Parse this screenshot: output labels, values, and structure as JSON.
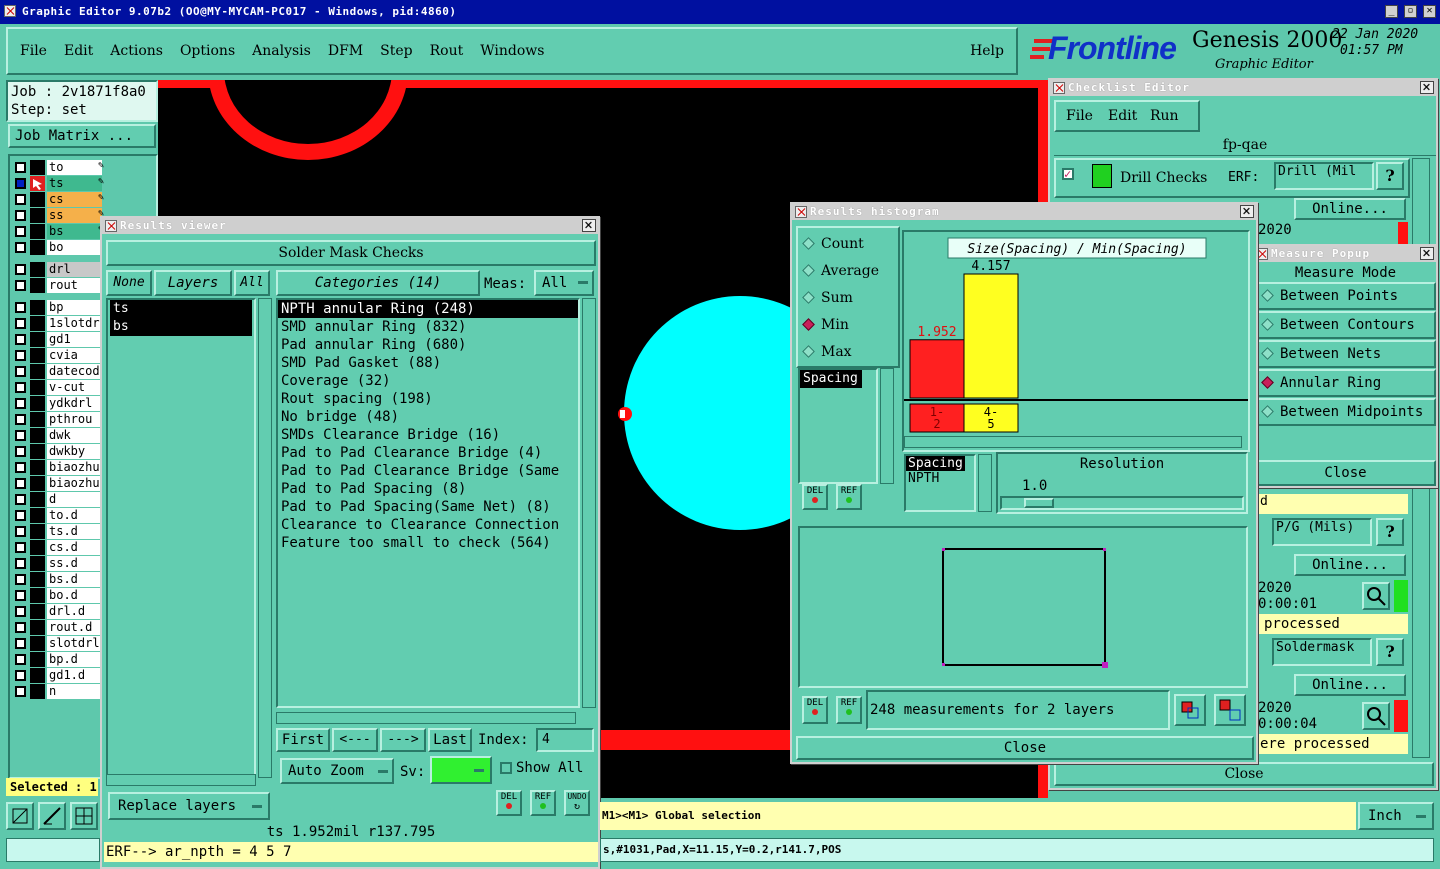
{
  "window": {
    "title": "Graphic Editor 9.07b2 (OO@MY-MYCAM-PC017 - Windows, pid:4860)"
  },
  "menu": [
    "File",
    "Edit",
    "Actions",
    "Options",
    "Analysis",
    "DFM",
    "Step",
    "Rout",
    "Windows"
  ],
  "help_label": "Help",
  "brand": {
    "logo": "Frontline",
    "product": "Genesis 2000",
    "subtitle": "Graphic Editor",
    "date": "22 Jan 2020",
    "time": "01:57 PM"
  },
  "job": {
    "job_label": "Job : 2v1871f8a0",
    "step_label": "Step: set",
    "matrix_button": "Job Matrix ..."
  },
  "layers_top": [
    {
      "name": "to",
      "color": "#ffffff",
      "mark": "pencil"
    },
    {
      "name": "ts",
      "color": "#3fb98f",
      "mark": "active"
    },
    {
      "name": "cs",
      "color": "#f5b04a",
      "mark": "pencil"
    },
    {
      "name": "ss",
      "color": "#f5b04a",
      "mark": "pencil"
    },
    {
      "name": "bs",
      "color": "#3fb98f",
      "mark": "pencil"
    },
    {
      "name": "bo",
      "color": "#ffffff",
      "mark": ""
    }
  ],
  "layers_drill": [
    "drl",
    "rout"
  ],
  "layers_other": [
    "bp",
    "1slotdrl",
    "gd1",
    "cvia",
    "datecode",
    "v-cut",
    "ydkdrl",
    "pthrou",
    "dwk",
    "dwkby",
    "biaozhu",
    "biaozhu",
    "d",
    "to.d",
    "ts.d",
    "cs.d",
    "ss.d",
    "bs.d",
    "bo.d",
    "drl.d",
    "rout.d",
    "slotdrl",
    "bp.d",
    "gd1.d",
    "n"
  ],
  "selected_label": "Selected : 1",
  "results_viewer": {
    "title": "Results viewer",
    "header": "Solder Mask Checks",
    "none_btn": "None",
    "layers_btn": "Layers",
    "all_btn": "All",
    "layers": [
      "ts",
      "bs"
    ],
    "categories_btn": "Categories (14)",
    "meas_label": "Meas:",
    "meas_value": "All",
    "categories": [
      "NPTH annular Ring (248)",
      "SMD annular Ring (832)",
      "Pad annular Ring (680)",
      "SMD Pad Gasket (88)",
      "Coverage (32)",
      "Rout spacing (198)",
      "No bridge (48)",
      "SMDs Clearance Bridge (16)",
      "Pad to Pad Clearance Bridge (4)",
      "Pad to Pad Clearance Bridge (Same",
      "Pad to Pad Spacing (8)",
      "Pad to Pad Spacing(Same Net) (8)",
      "Clearance to Clearance Connection",
      "Feature too small to check (564)"
    ],
    "first_btn": "First",
    "prev_btn": "<---",
    "next_btn": "--->",
    "last_btn": "Last",
    "index_label": "Index:",
    "index_value": "4",
    "zoom_value": "Auto Zoom",
    "sv_label": "Sv:",
    "show_all_label": "Show All",
    "replace_btn": "Replace layers",
    "del_label": "DEL",
    "ref_label": "REF",
    "undo_label": "UNDO",
    "status_line": "ts 1.952mil  r137.795",
    "erf_line": "ERF--> ar_npth = 4 5 7"
  },
  "histogram": {
    "title": "Results histogram",
    "modes": [
      {
        "label": "Count",
        "on": false
      },
      {
        "label": "Average",
        "on": false
      },
      {
        "label": "Sum",
        "on": false
      },
      {
        "label": "Min",
        "on": true
      },
      {
        "label": "Max",
        "on": false
      }
    ],
    "list_item": "Spacing",
    "chart_title": "Size(Spacing) / Min(Spacing)",
    "bar1_value": "1.952",
    "bar1_label": "1-\n 2",
    "bar2_value": "4.157",
    "bar2_label": "4-\n 5",
    "sel_label1": "Spacing",
    "sel_label2": "NPTH",
    "resolution_label": "Resolution",
    "resolution_value": "1.0",
    "del_label": "DEL",
    "ref_label": "REF",
    "summary": "248 measurements for 2 layers",
    "close_btn": "Close"
  },
  "chart_data": {
    "type": "bar",
    "title": "Size(Spacing) / Min(Spacing)",
    "categories": [
      "1-2",
      "4-5"
    ],
    "values": [
      1.952,
      4.157
    ],
    "colors": [
      "#ff2020",
      "#ffff20"
    ]
  },
  "checklist": {
    "title": "Checklist Editor",
    "menu": [
      "File",
      "Edit",
      "Run"
    ],
    "name": "fp-qae",
    "row1_label": "Drill Checks",
    "erf_label": "ERF:",
    "erf_value": "Drill (Mil",
    "online_btn": "Online...",
    "date_frag1": "2020",
    "pg_value": "P/G (Mils)",
    "date_frag2": "2020",
    "time_frag2": "0:00:01",
    "processed2": "processed",
    "sm_value": "Soldermask",
    "date_frag3": "2020",
    "time_frag3": "0:00:04",
    "processed3": "ere processed",
    "close_btn": "Close",
    "frag_d": "d",
    "q_label": "?"
  },
  "measure": {
    "title": "Measure Popup",
    "mode_label": "Measure Mode",
    "options": [
      {
        "label": "Between Points",
        "on": false
      },
      {
        "label": "Between Contours",
        "on": false
      },
      {
        "label": "Between Nets",
        "on": false
      },
      {
        "label": "Annular Ring",
        "on": true
      },
      {
        "label": "Between Midpoints",
        "on": false
      }
    ],
    "close_btn": "Close"
  },
  "status": {
    "message": "M1><M1> Global selection",
    "units": "Inch",
    "info": "s,#1031,Pad,X=11.15,Y=0.2,r141.7,POS"
  },
  "colors": {
    "panel": "#62cdb0",
    "canvas": "#000000",
    "copper_red": "#ff1010",
    "pad_cyan": "#00ffff"
  }
}
